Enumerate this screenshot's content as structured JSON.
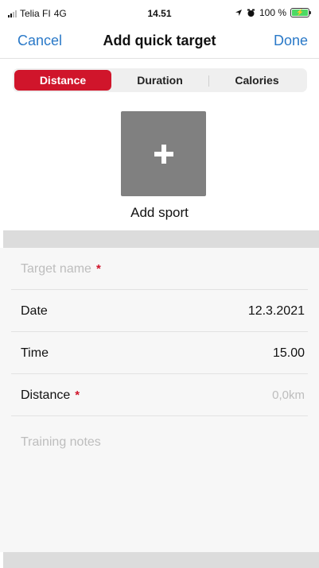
{
  "status_bar": {
    "carrier": "Telia FI",
    "network": "4G",
    "time": "14.51",
    "battery": "100 %",
    "icons": [
      "signal-icon",
      "location-arrow-icon",
      "alarm-icon",
      "battery-charging-icon"
    ]
  },
  "nav": {
    "cancel_label": "Cancel",
    "title": "Add quick target",
    "done_label": "Done"
  },
  "segments": [
    {
      "label": "Distance",
      "active": true
    },
    {
      "label": "Duration",
      "active": false
    },
    {
      "label": "Calories",
      "active": false
    }
  ],
  "add_sport": {
    "label": "Add sport",
    "icon": "plus-icon"
  },
  "form": {
    "target_name": {
      "placeholder": "Target name",
      "required_mark": "*"
    },
    "date": {
      "label": "Date",
      "value": "12.3.2021"
    },
    "time": {
      "label": "Time",
      "value": "15.00"
    },
    "distance": {
      "label": "Distance",
      "required_mark": "*",
      "placeholder": "0,0km"
    },
    "notes": {
      "placeholder": "Training notes"
    }
  },
  "colors": {
    "accent_red": "#d0152b",
    "link_blue": "#2a79c8",
    "tile_gray": "#808080",
    "band_gray": "#dcdcdc"
  }
}
